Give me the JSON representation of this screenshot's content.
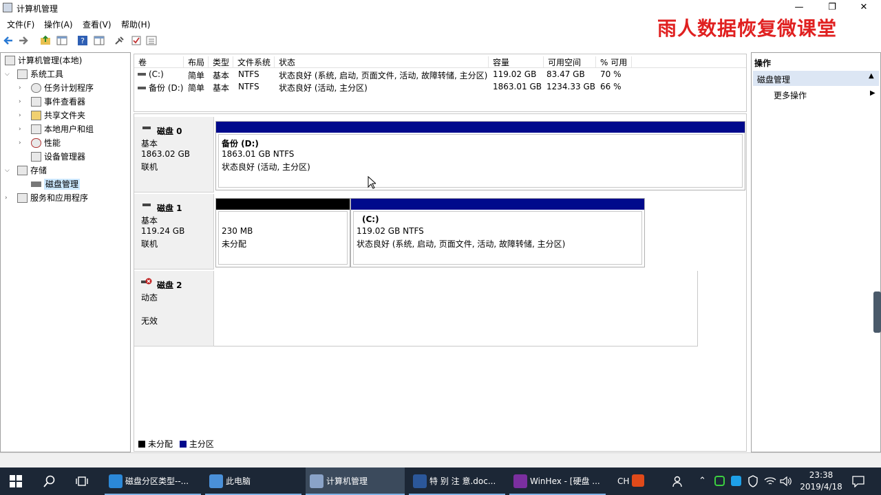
{
  "window": {
    "title": "计算机管理",
    "minimize": "—",
    "restore": "❐",
    "close": "✕"
  },
  "watermark": "雨人数据恢复微课堂",
  "menu": [
    "文件(F)",
    "操作(A)",
    "查看(V)",
    "帮助(H)"
  ],
  "tree": {
    "root": "计算机管理(本地)",
    "system_tools": "系统工具",
    "task_scheduler": "任务计划程序",
    "event_viewer": "事件查看器",
    "shared_folders": "共享文件夹",
    "local_users": "本地用户和组",
    "performance": "性能",
    "device_manager": "设备管理器",
    "storage": "存储",
    "disk_management": "磁盘管理",
    "services_apps": "服务和应用程序"
  },
  "volume_table": {
    "headers": [
      "卷",
      "布局",
      "类型",
      "文件系统",
      "状态",
      "容量",
      "可用空间",
      "% 可用"
    ],
    "rows": [
      [
        "(C:)",
        "简单",
        "基本",
        "NTFS",
        "状态良好 (系统, 启动, 页面文件, 活动, 故障转储, 主分区)",
        "119.02 GB",
        "83.47 GB",
        "70 %"
      ],
      [
        "备份 (D:)",
        "简单",
        "基本",
        "NTFS",
        "状态良好 (活动, 主分区)",
        "1863.01 GB",
        "1234.33 GB",
        "66 %"
      ]
    ]
  },
  "disks": [
    {
      "name": "磁盘 0",
      "type": "基本",
      "size": "1863.02 GB",
      "status": "联机",
      "partitions": [
        {
          "title": "备份  (D:)",
          "size": "1863.01 GB NTFS",
          "status": "状态良好 (活动, 主分区)",
          "color": "#000a8c"
        }
      ]
    },
    {
      "name": "磁盘 1",
      "type": "基本",
      "size": "119.24 GB",
      "status": "联机",
      "partitions": [
        {
          "title": "",
          "size": "230 MB",
          "status": "未分配",
          "color": "#000000"
        },
        {
          "title": "(C:)",
          "size": "119.02 GB NTFS",
          "status": "状态良好 (系统, 启动, 页面文件, 活动, 故障转储, 主分区)",
          "color": "#000a8c"
        }
      ]
    },
    {
      "name": "磁盘 2",
      "type": "动态",
      "size": "",
      "status": "无效"
    }
  ],
  "legend": [
    {
      "label": "未分配",
      "color": "#000000"
    },
    {
      "label": "主分区",
      "color": "#000a8c"
    }
  ],
  "actions": {
    "header": "操作",
    "section": "磁盘管理",
    "more": "更多操作"
  },
  "taskbar": {
    "tasks": [
      {
        "label": "磁盘分区类型--...",
        "icon_color": "#2b88d8"
      },
      {
        "label": "此电脑",
        "icon_color": "#4a90d9"
      },
      {
        "label": "计算机管理",
        "icon_color": "#8aa3c8"
      },
      {
        "label": "特 别 注 意.doc...",
        "icon_color": "#2b579a"
      },
      {
        "label": "WinHex - [硬盘 ...",
        "icon_color": "#7b2fa0"
      }
    ],
    "lang": "CH",
    "time": "23:38",
    "date": "2019/4/18"
  }
}
